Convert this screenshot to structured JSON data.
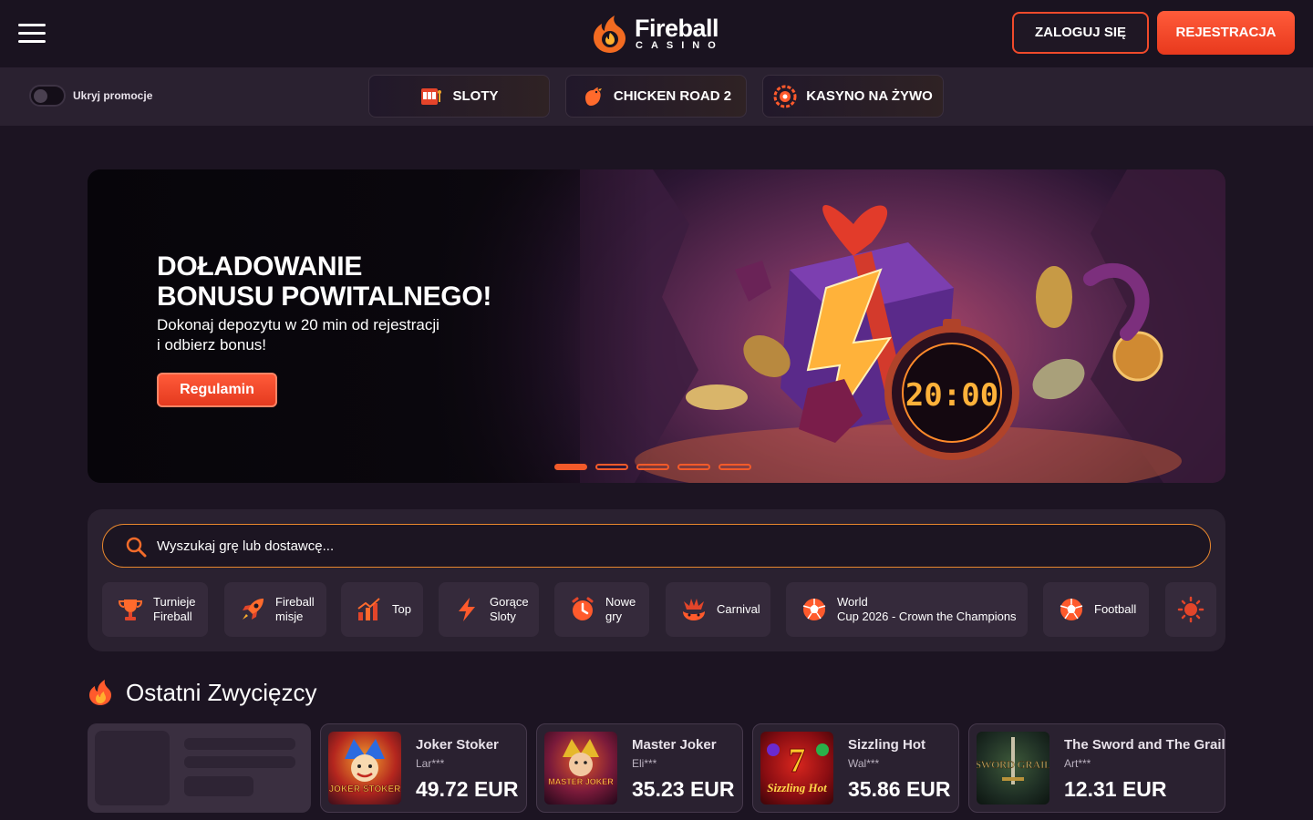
{
  "header": {
    "logo_word": "Fireball",
    "logo_sub": "CASINO",
    "login_label": "ZALOGUJ SIĘ",
    "register_label": "REJESTRACJA",
    "accent": "#f04a2b"
  },
  "promo_bar": {
    "hide_promos_label": "Ukryj promocje",
    "hide_promos_on": false,
    "links": [
      {
        "label": "SLOTY",
        "icon": "slot-machine-icon"
      },
      {
        "label": "CHICKEN ROAD 2",
        "icon": "chicken-icon"
      },
      {
        "label": "KASYNO NA ŻYWO",
        "icon": "roulette-icon"
      }
    ]
  },
  "hero": {
    "title_line1": "DOŁADOWANIE",
    "title_line2": "BONUSU POWITALNEGO!",
    "text_line1": "Dokonaj depozytu w 20 min od rejestracji",
    "text_line2": "i odbierz bonus!",
    "button_label": "Regulamin",
    "timer": "20:00",
    "slides_total": 5,
    "active_slide": 1
  },
  "search": {
    "placeholder": "Wyszukaj grę lub dostawcę..."
  },
  "categories": [
    {
      "line1": "Turnieje",
      "line2": "Fireball",
      "icon": "trophy-icon"
    },
    {
      "line1": "Fireball",
      "line2": "misje",
      "icon": "rocket-icon"
    },
    {
      "line1": "Top",
      "line2": "",
      "icon": "chart-icon"
    },
    {
      "line1": "Gorące",
      "line2": "Sloty",
      "icon": "lightning-icon"
    },
    {
      "line1": "Nowe",
      "line2": "gry",
      "icon": "clock-icon"
    },
    {
      "line1": "Carnival",
      "line2": "",
      "icon": "carnival-icon"
    },
    {
      "line1": "World",
      "line2": "Cup 2026 - Crown the Champions",
      "icon": "soccer-ball-icon"
    },
    {
      "line1": "Football",
      "line2": "",
      "icon": "soccer-ball-icon"
    },
    {
      "line1": "",
      "line2": "",
      "icon": "sun-icon"
    }
  ],
  "winners": {
    "title": "Ostatni Zwycięzcy",
    "items": [
      {
        "game": "Joker Stoker",
        "user": "Lar***",
        "amount": "49.72 EUR",
        "thumb_label": "JOKER STOKER"
      },
      {
        "game": "Master Joker",
        "user": "Eli***",
        "amount": "35.23 EUR",
        "thumb_label": "MASTER JOKER"
      },
      {
        "game": "Sizzling Hot",
        "user": "Wal***",
        "amount": "35.86 EUR",
        "thumb_label": "Sizzling Hot"
      },
      {
        "game": "The Sword and The Grail",
        "user": "Art***",
        "amount": "12.31 EUR",
        "thumb_label": "SWORD GRAIL"
      }
    ]
  }
}
